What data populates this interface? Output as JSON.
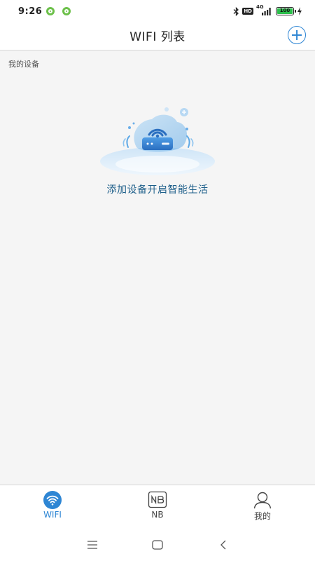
{
  "status_bar": {
    "time": "9:26",
    "network": "4G",
    "hd": "HD",
    "battery": "100",
    "colors": {
      "app_dot": "#6cc04a",
      "battery": "#2bbf4b"
    }
  },
  "header": {
    "title": "WIFI 列表",
    "add_icon": "plus-circle-icon",
    "accent": "#2e86d4"
  },
  "main": {
    "section_label": "我的设备",
    "empty_message": "添加设备开启智能生活",
    "illustration_icon": "wifi-router-illustration"
  },
  "tabs": [
    {
      "label": "WIFI",
      "icon": "wifi-icon",
      "active": true
    },
    {
      "label": "NB",
      "icon": "nb-icon",
      "active": false
    },
    {
      "label": "我的",
      "icon": "person-icon",
      "active": false
    }
  ],
  "system_nav": {
    "icons": [
      "menu-icon",
      "home-icon",
      "back-icon"
    ]
  }
}
